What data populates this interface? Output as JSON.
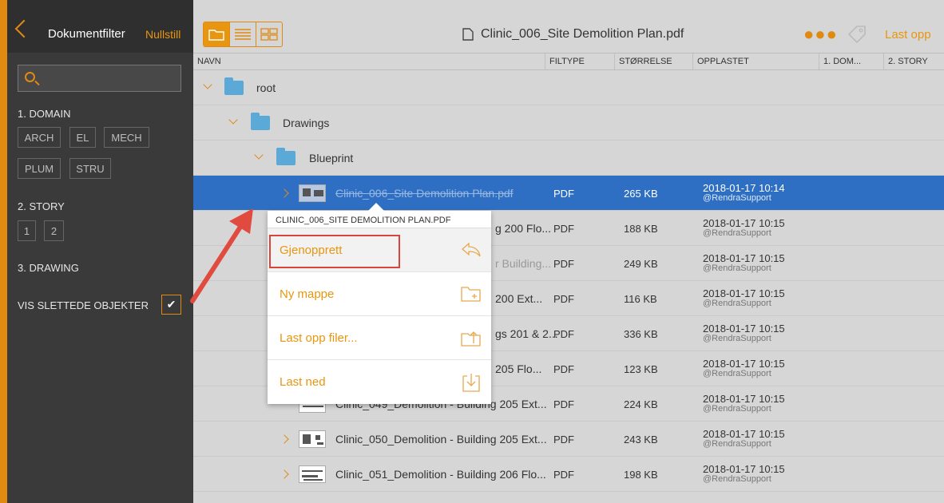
{
  "sidebar": {
    "title": "Dokumentfilter",
    "reset_label": "Nullstill",
    "search_placeholder": "",
    "sections": [
      {
        "label": "1. DOMAIN",
        "chips": [
          "ARCH",
          "EL",
          "MECH",
          "PLUM",
          "STRU"
        ]
      },
      {
        "label": "2. STORY",
        "chips": [
          "1",
          "2"
        ]
      },
      {
        "label": "3. DRAWING",
        "chips": []
      }
    ],
    "show_deleted_label": "VIS SLETTEDE OBJEKTER",
    "show_deleted_checked": true
  },
  "topbar": {
    "file_title": "Clinic_006_Site Demolition Plan.pdf",
    "upload_label": "Last opp",
    "active_view": "folder"
  },
  "columns": [
    "NAVN",
    "FILTYPE",
    "STØRRELSE",
    "OPPLASTET",
    "1. DOM...",
    "2. STORY"
  ],
  "tree": {
    "root": "root",
    "drawings": "Drawings",
    "blueprint": "Blueprint"
  },
  "files": [
    {
      "name": "Clinic_006_Site Demolition Plan.pdf",
      "type": "PDF",
      "size": "265 KB",
      "date": "2018-01-17 10:14",
      "user": "@RendraSupport",
      "selected": true,
      "deleted": true
    },
    {
      "name": "g 200 Flo...",
      "type": "PDF",
      "size": "188 KB",
      "date": "2018-01-17 10:15",
      "user": "@RendraSupport"
    },
    {
      "name": "r Building...",
      "type": "PDF",
      "size": "249 KB",
      "date": "2018-01-17 10:15",
      "user": "@RendraSupport",
      "deleted": true
    },
    {
      "name": "200 Ext...",
      "type": "PDF",
      "size": "116 KB",
      "date": "2018-01-17 10:15",
      "user": "@RendraSupport"
    },
    {
      "name": "gs 201 & 2...",
      "type": "PDF",
      "size": "336 KB",
      "date": "2018-01-17 10:15",
      "user": "@RendraSupport"
    },
    {
      "name": "205 Flo...",
      "type": "PDF",
      "size": "123 KB",
      "date": "2018-01-17 10:15",
      "user": "@RendraSupport"
    },
    {
      "name": "Clinic_049_Demolition - Building 205 Ext...",
      "type": "PDF",
      "size": "224 KB",
      "date": "2018-01-17 10:15",
      "user": "@RendraSupport"
    },
    {
      "name": "Clinic_050_Demolition - Building 205 Ext...",
      "type": "PDF",
      "size": "243 KB",
      "date": "2018-01-17 10:15",
      "user": "@RendraSupport"
    },
    {
      "name": "Clinic_051_Demolition - Building 206 Flo...",
      "type": "PDF",
      "size": "198 KB",
      "date": "2018-01-17 10:15",
      "user": "@RendraSupport"
    }
  ],
  "context_menu": {
    "header": "CLINIC_006_SITE DEMOLITION PLAN.PDF",
    "items": [
      {
        "label": "Gjenopprett",
        "icon": "restore-icon"
      },
      {
        "label": "Ny mappe",
        "icon": "new-folder-icon"
      },
      {
        "label": "Last opp filer...",
        "icon": "upload-folder-icon"
      },
      {
        "label": "Last ned",
        "icon": "download-icon"
      }
    ]
  },
  "colors": {
    "accent": "#e8960f",
    "selection": "#2f6fc3",
    "sidebar": "#3a3a3a",
    "highlight_box": "#d9443b",
    "arrow": "#e04a3f"
  }
}
